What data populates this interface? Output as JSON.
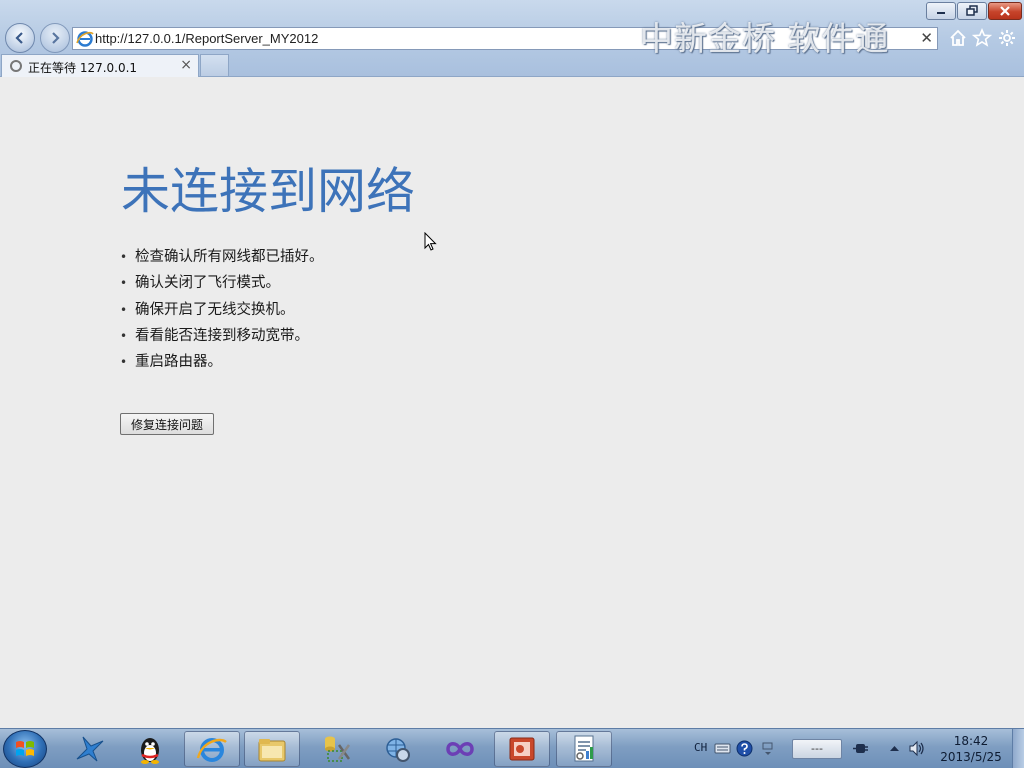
{
  "browser": {
    "address": "http://127.0.0.1/ReportServer_MY2012",
    "watermark": "中新金桥 软件通",
    "tab": {
      "title": "正在等待 127.0.0.1",
      "close": "×"
    },
    "address_close": "✕"
  },
  "content": {
    "title": "未连接到网络",
    "tips": [
      "检查确认所有网线都已插好。",
      "确认关闭了飞行模式。",
      "确保开启了无线交换机。",
      "看看能否连接到移动宽带。",
      "重启路由器。"
    ],
    "bullet": "•",
    "fix_button": "修复连接问题"
  },
  "taskbar": {
    "apps": [
      {
        "name": "bird-app-icon",
        "running": false
      },
      {
        "name": "qq-penguin-icon",
        "running": false
      },
      {
        "name": "internet-explorer-icon",
        "running": true
      },
      {
        "name": "file-explorer-icon",
        "running": true
      },
      {
        "name": "database-tools-icon",
        "running": false
      },
      {
        "name": "search-globe-icon",
        "running": false
      },
      {
        "name": "visual-studio-infinity-icon",
        "running": false
      },
      {
        "name": "powerpoint-icon",
        "running": true
      },
      {
        "name": "report-builder-icon",
        "running": true
      }
    ],
    "tray": {
      "language": "CH",
      "battery_text": "---",
      "time": "18:42",
      "date": "2013/5/25"
    }
  },
  "colors": {
    "title_blue": "#3d73b9",
    "taskbar": "#7f9ec2",
    "close_red": "#c6432a"
  }
}
